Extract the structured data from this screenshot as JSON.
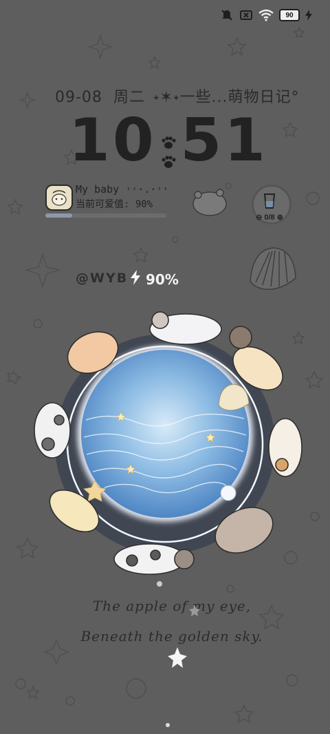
{
  "status_bar": {
    "icons": [
      "mute-bell-icon",
      "no-sim-icon",
      "wifi-icon",
      "battery-icon",
      "charging-bolt-icon"
    ],
    "battery_level": "90"
  },
  "date_line": {
    "date": "09-08",
    "weekday": "周二",
    "tagline": "˖✶˖一些...萌物日记°"
  },
  "clock": {
    "hour": "10",
    "minute": "51"
  },
  "pet_widget": {
    "name": "My baby ˒˓·.·˒˓",
    "cuteness": "当前可爱值: 90%",
    "progress_fraction": 0.22
  },
  "water_widget": {
    "count": "⊖ 0/8 ⊕"
  },
  "charging": {
    "handle": "@WYB",
    "percent": "90%"
  },
  "quote": {
    "line1": "The apple of my eye,",
    "line2": "Beneath the golden sky."
  },
  "colors": {
    "background": "#5e5e5e",
    "ocean": "#6fa3d6",
    "ring_glow": "#f2f6ff"
  }
}
